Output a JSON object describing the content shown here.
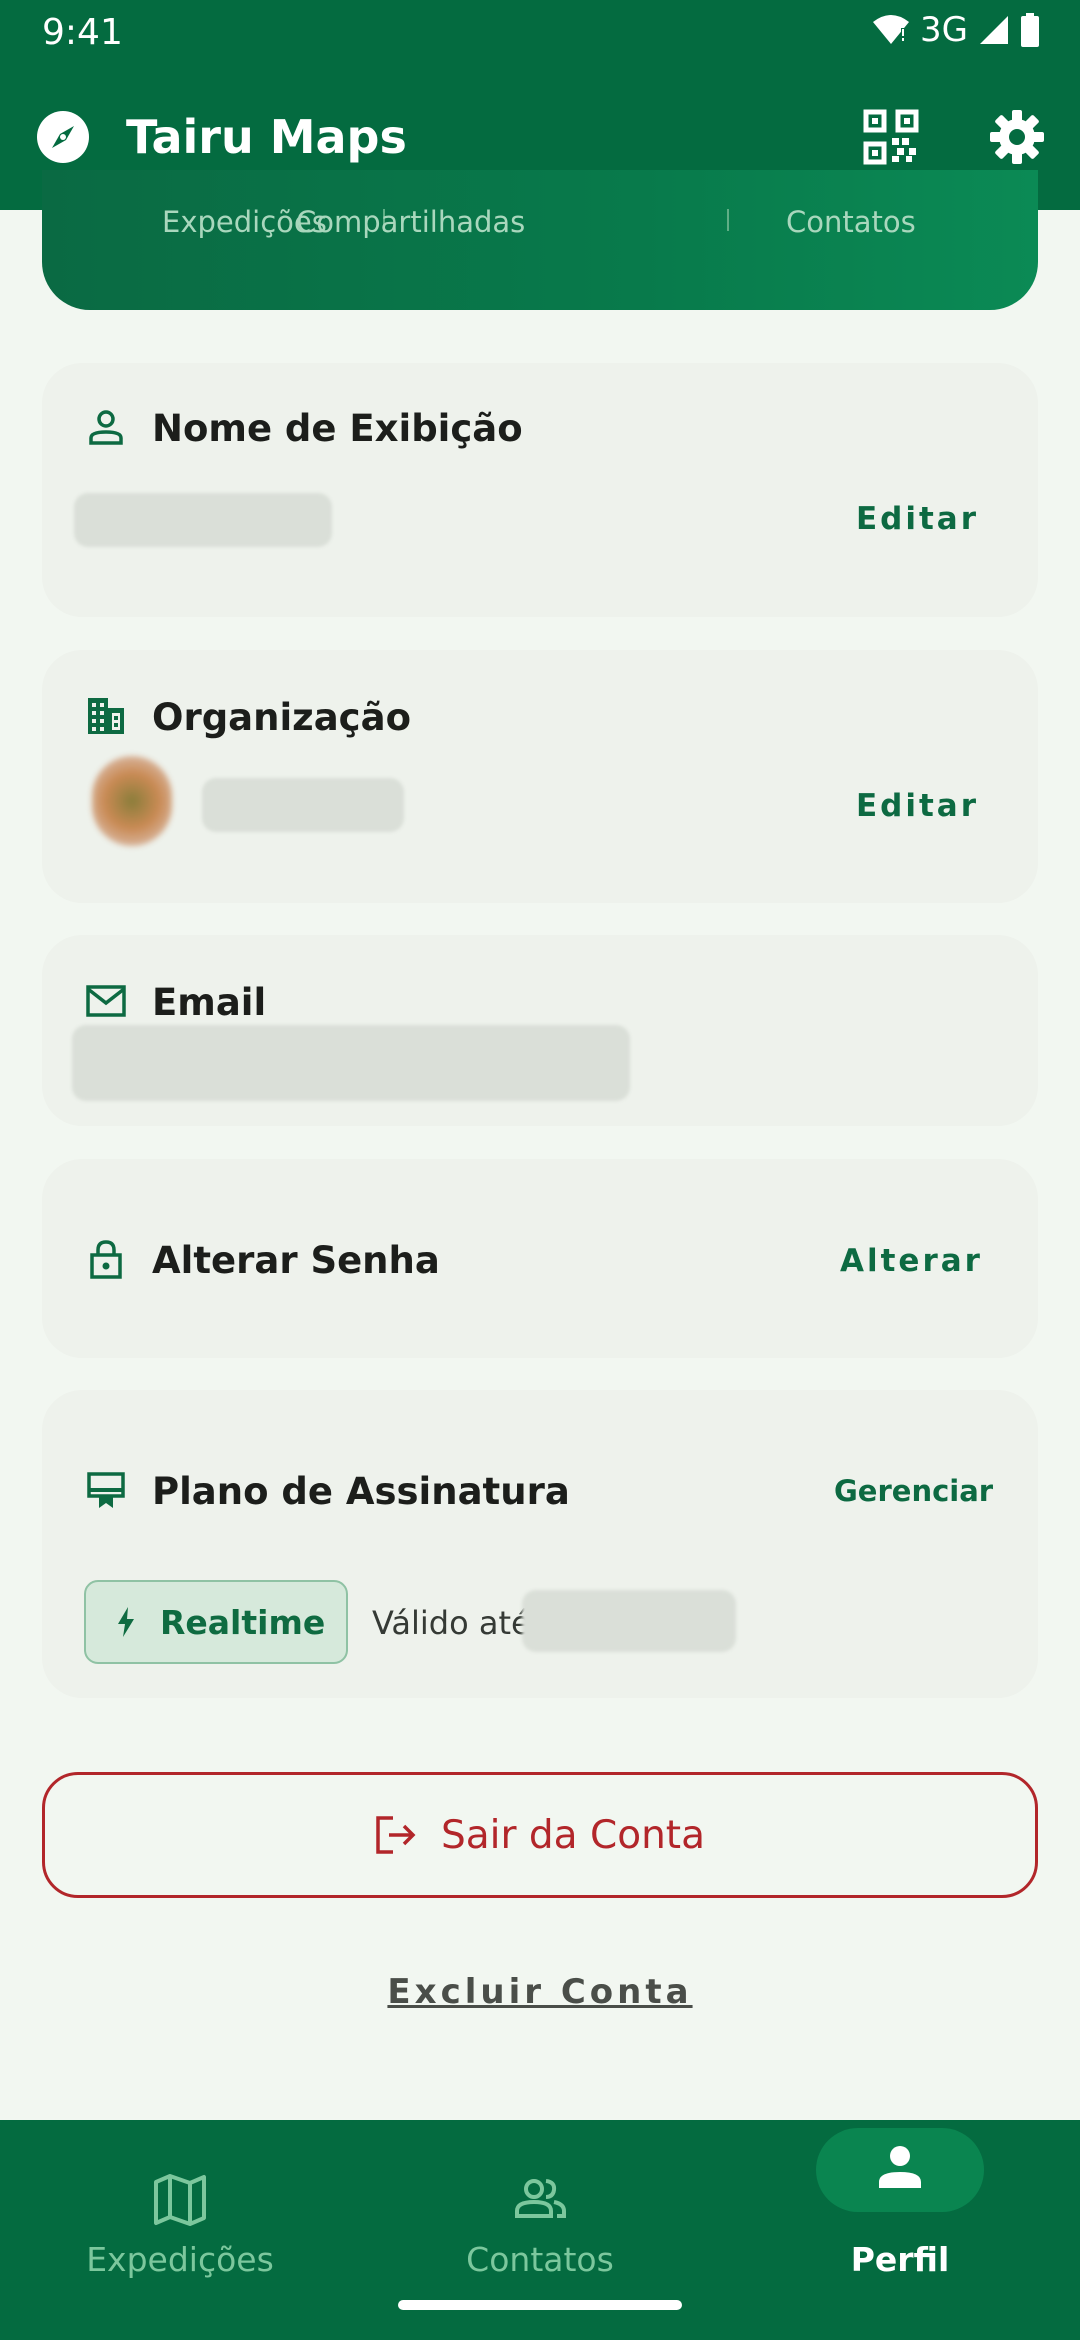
{
  "status_bar": {
    "time": "9:41",
    "network": "3G"
  },
  "app_bar": {
    "title": "Tairu Maps"
  },
  "stats_tabs": [
    "Expedições",
    "Compartilhadas",
    "Contatos"
  ],
  "cards": {
    "display_name": {
      "title": "Nome de Exibição",
      "action": "Editar"
    },
    "organization": {
      "title": "Organização",
      "action": "Editar"
    },
    "email": {
      "title": "Email"
    },
    "password": {
      "title": "Alterar Senha",
      "action": "Alterar"
    },
    "subscription": {
      "title": "Plano de Assinatura",
      "action": "Gerenciar",
      "plan_chip": "Realtime",
      "valid_until_label": "Válido até"
    }
  },
  "logout_label": "Sair da Conta",
  "delete_label": "Excluir Conta",
  "bottom_nav": [
    {
      "label": "Expedições",
      "icon": "map-icon"
    },
    {
      "label": "Contatos",
      "icon": "people-icon"
    },
    {
      "label": "Perfil",
      "icon": "person-icon",
      "active": true
    }
  ],
  "colors": {
    "primary": "#046b40",
    "danger": "#b2262a",
    "surface": "#eef2ec",
    "background": "#f2f7f1"
  }
}
